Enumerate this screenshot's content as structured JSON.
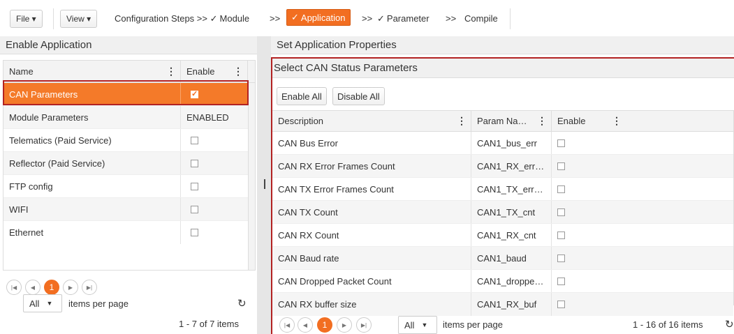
{
  "toolbar": {
    "file_label": "File ▾",
    "view_label": "View ▾",
    "steps_prefix": "Configuration Steps >>",
    "step_module": "Module",
    "sep1": ">>",
    "step_application": "Application",
    "sep2": ">>",
    "step_parameter": "Parameter",
    "sep3": ">>",
    "step_compile": "Compile"
  },
  "left": {
    "title": "Enable Application",
    "columns": [
      "Name",
      "Enable"
    ],
    "rows": [
      {
        "name": "CAN Parameters",
        "enable": "checked"
      },
      {
        "name": "Module Parameters",
        "enable": "ENABLED"
      },
      {
        "name": "Telematics (Paid Service)",
        "enable": "unchecked"
      },
      {
        "name": "Reflector (Paid Service)",
        "enable": "unchecked"
      },
      {
        "name": "FTP config",
        "enable": "unchecked"
      },
      {
        "name": "WIFI",
        "enable": "unchecked"
      },
      {
        "name": "Ethernet",
        "enable": "unchecked"
      }
    ],
    "pager": {
      "current": "1",
      "per_page": "All",
      "per_page_label": "items per page",
      "summary": "1 - 7 of 7 items"
    }
  },
  "right": {
    "title": "Set Application Properties",
    "subtitle": "Select CAN Status Parameters",
    "enable_all": "Enable All",
    "disable_all": "Disable All",
    "columns": [
      "Description",
      "Param Na…",
      "Enable"
    ],
    "rows": [
      {
        "desc": "CAN Bus Error",
        "param": "CAN1_bus_err"
      },
      {
        "desc": "CAN RX Error Frames Count",
        "param": "CAN1_RX_err…"
      },
      {
        "desc": "CAN TX Error Frames Count",
        "param": "CAN1_TX_err…"
      },
      {
        "desc": "CAN TX Count",
        "param": "CAN1_TX_cnt"
      },
      {
        "desc": "CAN RX Count",
        "param": "CAN1_RX_cnt"
      },
      {
        "desc": "CAN Baud rate",
        "param": "CAN1_baud"
      },
      {
        "desc": "CAN Dropped Packet Count",
        "param": "CAN1_droppe…"
      },
      {
        "desc": "CAN RX buffer size",
        "param": "CAN1_RX_buf"
      }
    ],
    "pager": {
      "current": "1",
      "per_page": "All",
      "per_page_label": "items per page",
      "summary": "1 - 16 of 16 items"
    }
  },
  "colors": {
    "accent": "#f26e21",
    "outline": "#b22222"
  }
}
